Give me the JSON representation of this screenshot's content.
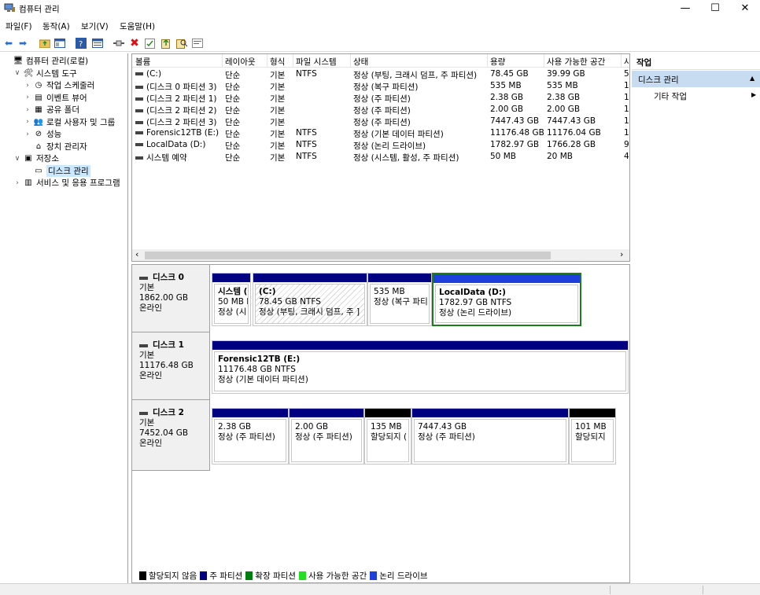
{
  "window": {
    "title": "컴퓨터 관리",
    "minimize": "—",
    "maximize": "☐",
    "close": "✕"
  },
  "menu": [
    "파일(F)",
    "동작(A)",
    "보기(V)",
    "도움말(H)"
  ],
  "toolbar_icons": [
    "back-arrow-icon",
    "forward-arrow-icon",
    "up-folder-icon",
    "console-tree-icon",
    "help-icon",
    "properties-icon",
    "connect-icon",
    "delete-icon",
    "check-icon",
    "export-icon",
    "search-icon",
    "refresh-icon"
  ],
  "tree": [
    {
      "label": "컴퓨터 관리(로컬)",
      "level": 0,
      "exp": "",
      "icon": "computer-icon"
    },
    {
      "label": "시스템 도구",
      "level": 1,
      "exp": "∨",
      "icon": "tools-icon"
    },
    {
      "label": "작업 스케줄러",
      "level": 2,
      "exp": "›",
      "icon": "clock-icon"
    },
    {
      "label": "이벤트 뷰어",
      "level": 2,
      "exp": "›",
      "icon": "event-viewer-icon"
    },
    {
      "label": "공유 폴더",
      "level": 2,
      "exp": "›",
      "icon": "shared-folder-icon"
    },
    {
      "label": "로컬 사용자 및 그룹",
      "level": 2,
      "exp": "›",
      "icon": "users-icon"
    },
    {
      "label": "성능",
      "level": 2,
      "exp": "›",
      "icon": "performance-icon"
    },
    {
      "label": "장치 관리자",
      "level": 2,
      "exp": "",
      "icon": "device-manager-icon"
    },
    {
      "label": "저장소",
      "level": 1,
      "exp": "∨",
      "icon": "storage-icon"
    },
    {
      "label": "디스크 관리",
      "level": 2,
      "exp": "",
      "icon": "disk-management-icon",
      "selected": true
    },
    {
      "label": "서비스 및 응용 프로그램",
      "level": 1,
      "exp": "›",
      "icon": "services-icon"
    }
  ],
  "volume_table": {
    "columns": [
      "볼륨",
      "레이아웃",
      "형식",
      "파일 시스템",
      "상태",
      "용량",
      "사용 가능한 공간",
      "사"
    ],
    "rows": [
      [
        "(C:)",
        "단순",
        "기본",
        "NTFS",
        "정상 (부팅, 크래시 덤프, 주 파티션)",
        "78.45 GB",
        "39.99 GB",
        "51"
      ],
      [
        "(디스크 0 파티션 3)",
        "단순",
        "기본",
        "",
        "정상 (복구 파티션)",
        "535 MB",
        "535 MB",
        "1("
      ],
      [
        "(디스크 2 파티션 1)",
        "단순",
        "기본",
        "",
        "정상 (주 파티션)",
        "2.38 GB",
        "2.38 GB",
        "1("
      ],
      [
        "(디스크 2 파티션 2)",
        "단순",
        "기본",
        "",
        "정상 (주 파티션)",
        "2.00 GB",
        "2.00 GB",
        "1("
      ],
      [
        "(디스크 2 파티션 3)",
        "단순",
        "기본",
        "",
        "정상 (주 파티션)",
        "7447.43 GB",
        "7447.43 GB",
        "1("
      ],
      [
        "Forensic12TB (E:)",
        "단순",
        "기본",
        "NTFS",
        "정상 (기본 데이터 파티션)",
        "11176.48 GB",
        "11176.04 GB",
        "1("
      ],
      [
        "LocalData (D:)",
        "단순",
        "기본",
        "NTFS",
        "정상 (논리 드라이브)",
        "1782.97 GB",
        "1766.28 GB",
        "9("
      ],
      [
        "시스템 예약",
        "단순",
        "기본",
        "NTFS",
        "정상 (시스템, 활성, 주 파티션)",
        "50 MB",
        "20 MB",
        "4("
      ]
    ]
  },
  "scroll": {
    "left": "‹",
    "right": "›"
  },
  "disks": [
    {
      "name": "디스크 0",
      "type": "기본",
      "size": "1862.00 GB",
      "status": "온라인",
      "partitions": [
        {
          "title": "시스템 (",
          "lines": [
            "50 MB I",
            "정상 (시"
          ],
          "bar": "#000080",
          "style": "normal"
        },
        {
          "title": "(C:)",
          "lines": [
            "78.45 GB NTFS",
            "정상 (부팅, 크래시 덤프, 주 ]"
          ],
          "bar": "#000080",
          "style": "hatched"
        },
        {
          "title": "",
          "lines": [
            "535 MB",
            "정상 (복구 파티"
          ],
          "bar": "#000080",
          "style": "normal"
        },
        {
          "title": "LocalData  (D:)",
          "lines": [
            "1782.97 GB NTFS",
            "정상 (논리 드라이브)"
          ],
          "bar": "#1f3fdc",
          "style": "extended"
        }
      ]
    },
    {
      "name": "디스크 1",
      "type": "기본",
      "size": "11176.48 GB",
      "status": "온라인",
      "partitions": [
        {
          "title": "Forensic12TB  (E:)",
          "lines": [
            "11176.48 GB NTFS",
            "정상 (기본 데이터 파티션)"
          ],
          "bar": "#000080",
          "style": "normal"
        }
      ]
    },
    {
      "name": "디스크 2",
      "type": "기본",
      "size": "7452.04 GB",
      "status": "온라인",
      "partitions": [
        {
          "title": "",
          "lines": [
            "2.38 GB",
            "정상 (주 파티션)"
          ],
          "bar": "#000080",
          "style": "normal"
        },
        {
          "title": "",
          "lines": [
            "2.00 GB",
            "정상 (주 파티션)"
          ],
          "bar": "#000080",
          "style": "normal"
        },
        {
          "title": "",
          "lines": [
            "135 MB",
            "할당되지 ("
          ],
          "bar": "#000000",
          "style": "normal"
        },
        {
          "title": "",
          "lines": [
            "7447.43 GB",
            "정상 (주 파티션)"
          ],
          "bar": "#000080",
          "style": "normal"
        },
        {
          "title": "",
          "lines": [
            "101 MB",
            "할당되지"
          ],
          "bar": "#000000",
          "style": "normal"
        }
      ]
    }
  ],
  "legend": [
    {
      "label": "할당되지 않음",
      "color": "#000000"
    },
    {
      "label": "주 파티션",
      "color": "#000080"
    },
    {
      "label": "확장 파티션",
      "color": "#007f0e"
    },
    {
      "label": "사용 가능한 공간",
      "color": "#21e021"
    },
    {
      "label": "논리 드라이브",
      "color": "#1f3fdc"
    }
  ],
  "actions": {
    "header": "작업",
    "section": "디스크 관리",
    "section_arrow": "▲",
    "item": "기타 작업",
    "item_arrow": "▶"
  }
}
